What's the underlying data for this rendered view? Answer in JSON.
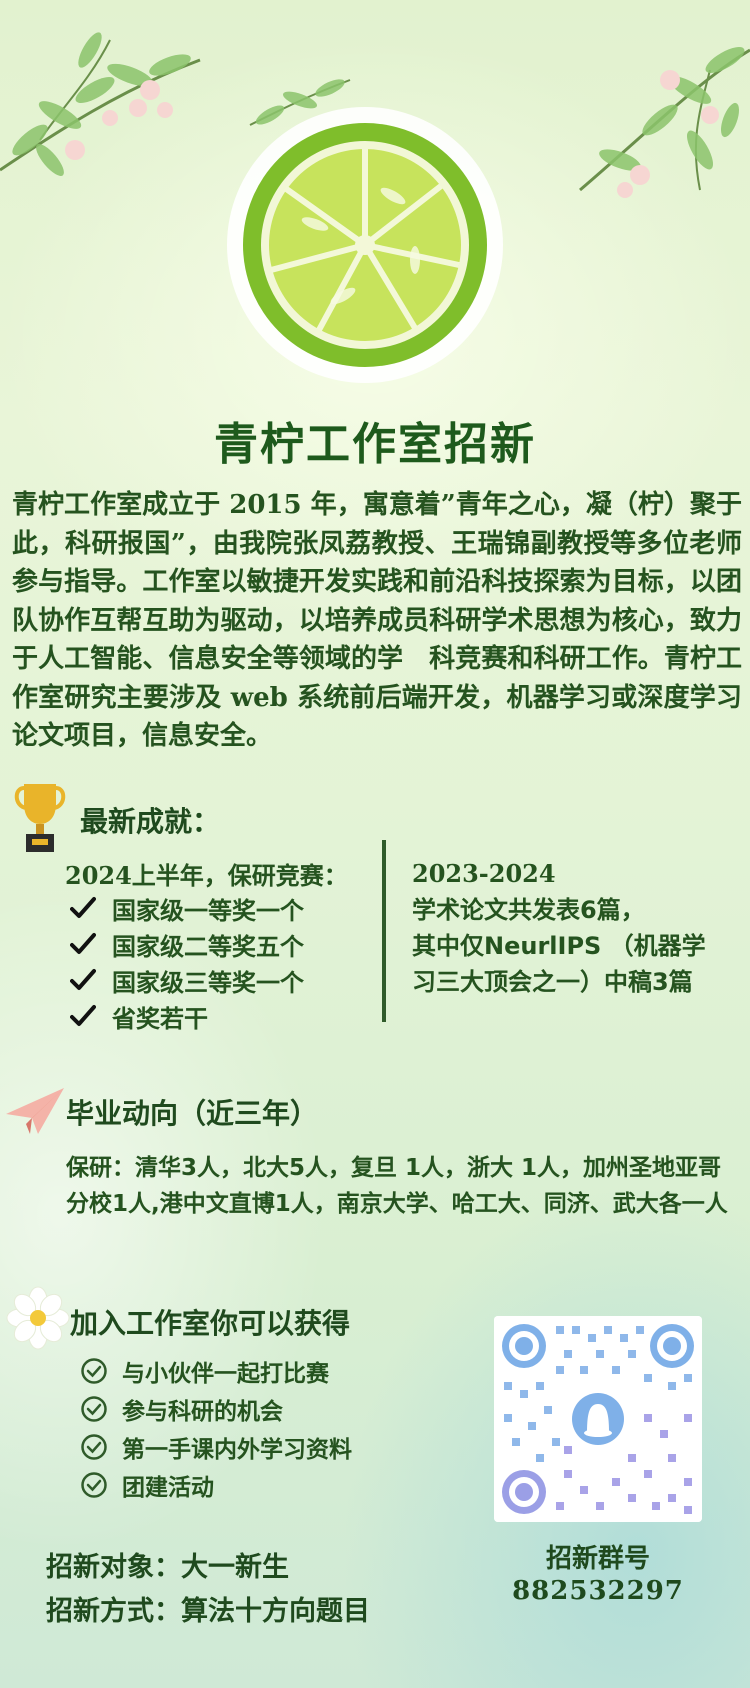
{
  "title": "青柠工作室招新",
  "intro": "青柠工作室成立于 2015 年，寓意着”青年之心，凝（柠）聚于此，科研报国”，由我院张凤荔教授、王瑞锦副教授等多位老师参与指导。工作室以敏捷开发实践和前沿科技探索为目标，以团队协作互帮互助为驱动，以培养成员科研学术思想为核心，致力于人工智能、信息安全等领域的学　科竞赛和科研工作。青柠工作室研究主要涉及 web 系统前后端开发，机器学习或深度学习论文项目，信息安全。",
  "achievements": {
    "title": "最新成就：",
    "left_heading": "2024上半年，保研竞赛：",
    "left_items": [
      "国家级一等奖一个",
      "国家级二等奖五个",
      "国家级三等奖一个",
      "省奖若干"
    ],
    "right_lines": [
      "2023-2024",
      "学术论文共发表6篇，",
      "其中仅NeurlIPS （机器学",
      "习三大顶会之一）中稿3篇"
    ]
  },
  "graduation": {
    "title": "毕业动向（近三年）",
    "text": "保研：清华3人，北大5人，复旦 1人，浙大 1人，加州圣地亚哥分校1人,港中文直博1人，南京大学、哈工大、同济、武大各一人"
  },
  "join": {
    "title": "加入工作室你可以获得",
    "benefits": [
      "与小伙伴一起打比赛",
      "参与科研的机会",
      "第一手课内外学习资料",
      "团建活动"
    ]
  },
  "recruit": {
    "target": "招新对象：大一新生",
    "method": "招新方式：算法十方向题目"
  },
  "qr": {
    "label": "招新群号",
    "number": "882532297"
  },
  "colors": {
    "title_green": "#1e5a1c",
    "text_green": "#25531f",
    "lemon_outer": "#7fbe2b",
    "lemon_inner": "#c7e35c"
  }
}
